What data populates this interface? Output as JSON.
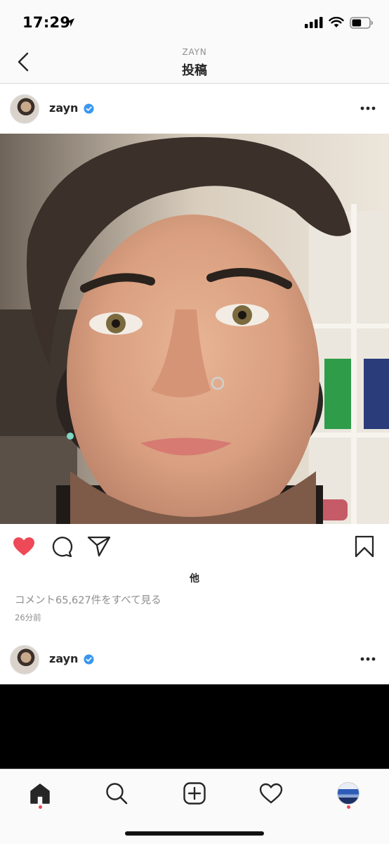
{
  "status_bar": {
    "time": "17:29",
    "location_icon": "location-arrow-icon",
    "signal_icon": "cellular-signal-icon",
    "wifi_icon": "wifi-icon",
    "battery_icon": "battery-icon",
    "battery_level": 0.55
  },
  "nav": {
    "back_icon": "chevron-left-icon",
    "subtitle": "ZAYN",
    "title": "投稿"
  },
  "post": {
    "username": "zayn",
    "verified": true,
    "more_icon": "ellipsis-icon",
    "liked": true,
    "like_color": "#ed4956",
    "likes_text": "他",
    "comments_link": "コメント65,627件をすべて見る",
    "timestamp": "26分前"
  },
  "next_post": {
    "username": "zayn",
    "verified": true,
    "more_icon": "ellipsis-icon"
  },
  "tab_bar": {
    "tabs": [
      {
        "icon": "home-icon",
        "active": true,
        "dot": true
      },
      {
        "icon": "search-icon",
        "active": false,
        "dot": false
      },
      {
        "icon": "add-post-icon",
        "active": false,
        "dot": false
      },
      {
        "icon": "heart-outline-icon",
        "active": false,
        "dot": false
      },
      {
        "icon": "profile-avatar-icon",
        "active": false,
        "dot": true
      }
    ],
    "notification_color": "#ed4956"
  },
  "colors": {
    "verified_blue": "#3897f0",
    "text_primary": "#262626",
    "text_secondary": "#8e8e8e"
  }
}
